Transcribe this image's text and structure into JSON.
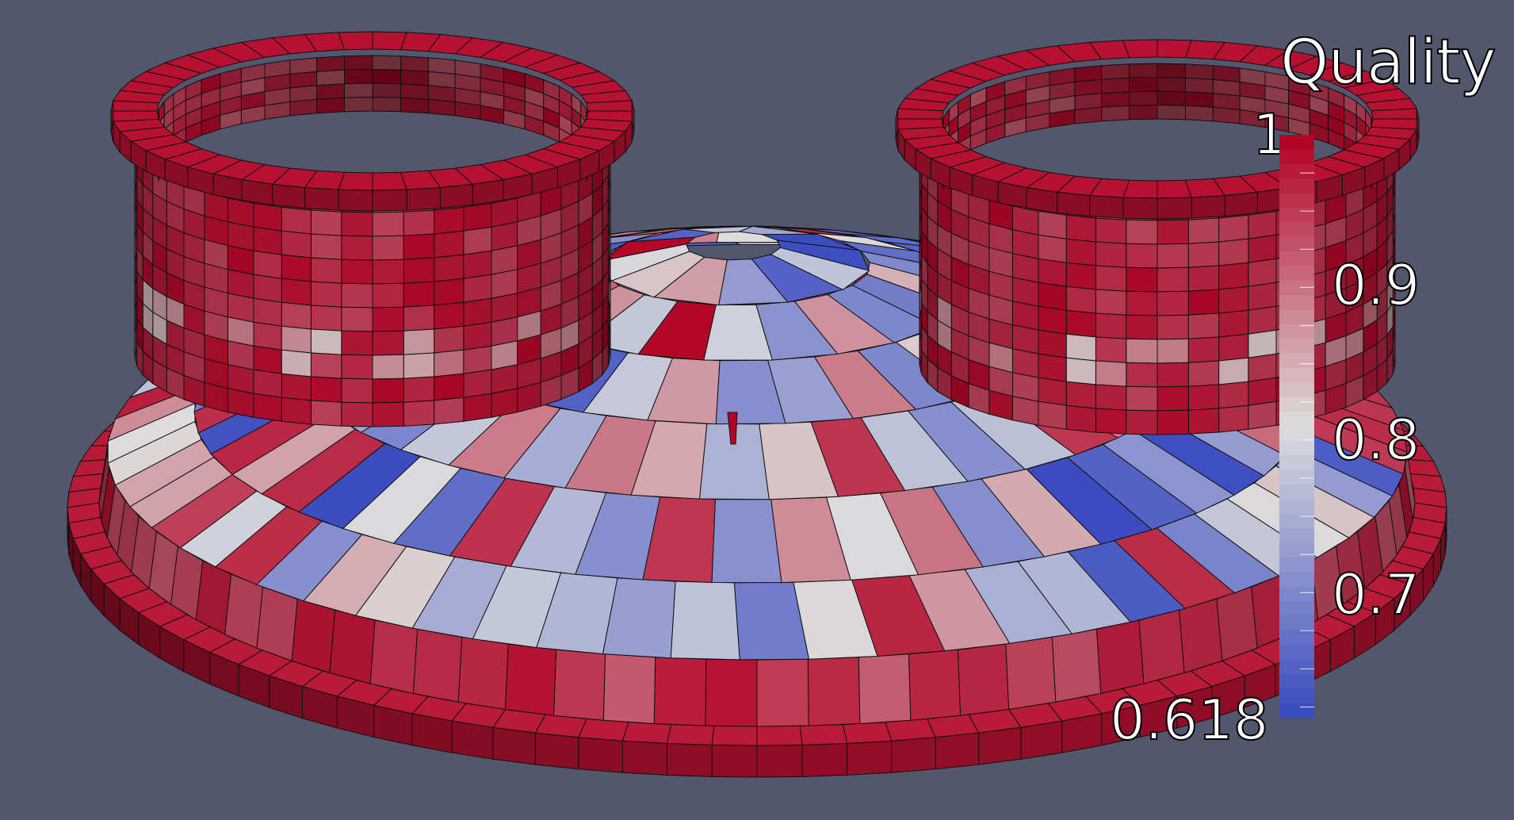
{
  "legend": {
    "title": "Quality",
    "max_label": "1",
    "min_label": "0.618",
    "ticks": [
      {
        "label": "0.9",
        "value": 0.9
      },
      {
        "label": "0.8",
        "value": 0.8
      },
      {
        "label": "0.7",
        "value": 0.7
      }
    ],
    "range": [
      0.618,
      1.0
    ]
  },
  "colors": {
    "background": "#52576e",
    "low": "#3b4cc0",
    "mid": "#dddddd",
    "high": "#b40426",
    "mesh_line": "#111111"
  }
}
